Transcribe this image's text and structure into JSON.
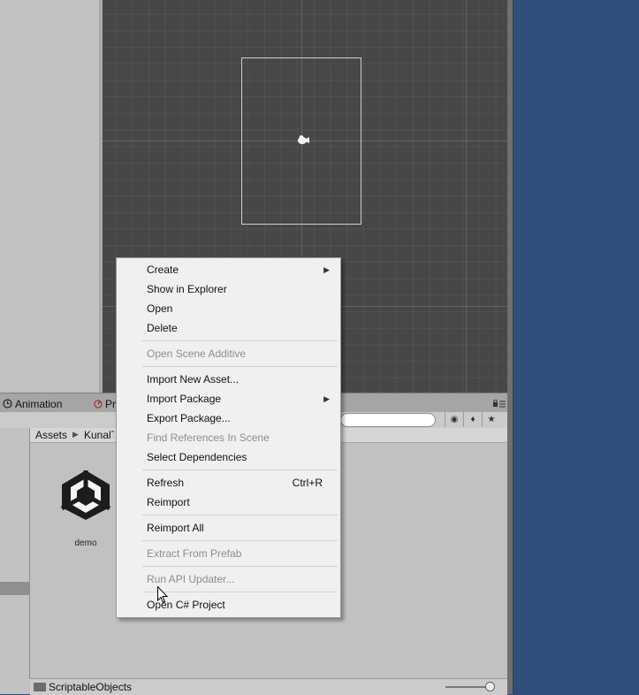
{
  "tabs": {
    "animation_label": "Animation",
    "project_label": "Pr"
  },
  "breadcrumb": {
    "root": "Assets",
    "folder": "KunalT"
  },
  "assets": [
    {
      "name": "demo",
      "icon": "unity-logo-icon"
    }
  ],
  "status_bar": {
    "path_label": "ScriptableObjects"
  },
  "context_menu": {
    "items": [
      {
        "label": "Create",
        "enabled": true,
        "submenu": true
      },
      {
        "label": "Show in Explorer",
        "enabled": true
      },
      {
        "label": "Open",
        "enabled": true
      },
      {
        "label": "Delete",
        "enabled": true
      },
      {
        "label": "Open Scene Additive",
        "enabled": false
      },
      {
        "label": "Import New Asset...",
        "enabled": true
      },
      {
        "label": "Import Package",
        "enabled": true,
        "submenu": true
      },
      {
        "label": "Export Package...",
        "enabled": true
      },
      {
        "label": "Find References In Scene",
        "enabled": false
      },
      {
        "label": "Select Dependencies",
        "enabled": true
      },
      {
        "label": "Refresh",
        "enabled": true,
        "shortcut": "Ctrl+R"
      },
      {
        "label": "Reimport",
        "enabled": true
      },
      {
        "label": "Reimport All",
        "enabled": true
      },
      {
        "label": "Extract From Prefab",
        "enabled": false
      },
      {
        "label": "Run API Updater...",
        "enabled": false
      },
      {
        "label": "Open C# Project",
        "enabled": true
      }
    ]
  },
  "colors": {
    "scene_background": "#474747",
    "desktop_background": "#2f4f7a",
    "menu_background": "#f0f0f0",
    "disabled_text": "#8d8d8d"
  }
}
